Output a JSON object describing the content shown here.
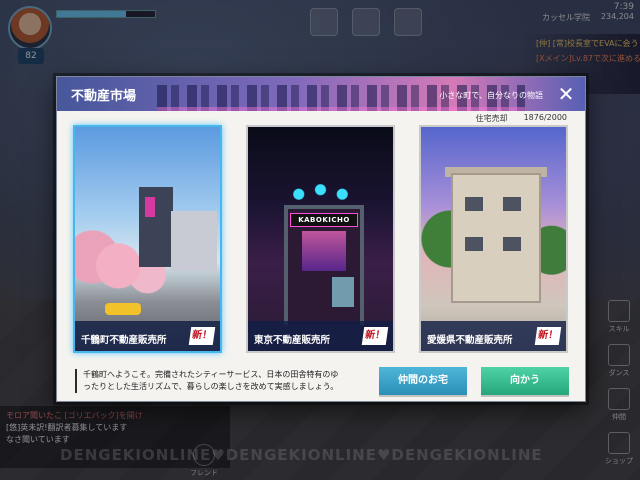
{
  "hud": {
    "level": "82",
    "hp_fraction": 0.7,
    "time": "7:39",
    "school": "カッセル学院",
    "coords": "234,204"
  },
  "quest": {
    "line1": "[仲] [常]校長室でEVAに会う",
    "line2": "[Xメイン]Lv.87で次に進める"
  },
  "side_menu": [
    "スキル",
    "ダンス",
    "仲間",
    "ショップ"
  ],
  "chat": {
    "line1": "モロア聞いたこ [ゴリエバック]を開け",
    "line2": "[悠]英未訳!翻訳者募集しています",
    "line3": "なさ聞いています"
  },
  "bottom_bar": {
    "friend": "フレンド"
  },
  "watermark": "DENGEKIONLINE♥DENGEKIONLINE♥DENGEKIONLINE",
  "modal": {
    "title": "不動産市場",
    "tagline": "小さな町で、自分なりの物語",
    "stats_label": "住宅売却",
    "stats_value": "1876/2000",
    "close_glyph": "✕",
    "cards": [
      {
        "label": "千鶴町不動産販売所",
        "badge": "新！",
        "selected": true
      },
      {
        "label": "東京不動産販売所",
        "badge": "新！",
        "selected": false,
        "sign": "KABOKICHO"
      },
      {
        "label": "愛媛県不動産販売所",
        "badge": "新！",
        "selected": false
      }
    ],
    "description": "千鶴町へようこそ。完備されたシティーサービス、日本の田舎特有のゆったりとした生活リズムで、暮らしの楽しさを改めて実感しましょう。",
    "buttons": {
      "friend_home": "仲間のお宅",
      "go": "向かう"
    }
  },
  "colors": {
    "accent_blue": "#47b7ee",
    "go_green": "#25a67a",
    "badge_red": "#c1121f"
  }
}
